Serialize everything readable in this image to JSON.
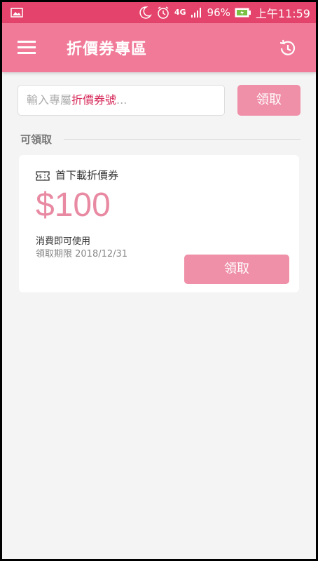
{
  "status_bar": {
    "image_icon": "image-icon",
    "night_icon": "moon-icon",
    "alarm_icon": "alarm-icon",
    "network": "4G",
    "signal_icon": "signal-icon",
    "battery_percent": "96%",
    "battery_icon": "battery-charging-icon",
    "time": "上午11:59"
  },
  "app_bar": {
    "menu_icon": "hamburger-menu-icon",
    "title": "折價券專區",
    "history_icon": "history-icon"
  },
  "code_entry": {
    "placeholder_prefix": "輸入專屬",
    "placeholder_accent": "折價券號",
    "placeholder_suffix": "...",
    "button_label": "領取"
  },
  "section": {
    "label": "可領取"
  },
  "coupon": {
    "icon": "ticket-icon",
    "name": "首下載折價券",
    "amount": "$100",
    "condition": "消費即可使用",
    "period": "領取期限 2018/12/31",
    "button_label": "領取"
  },
  "colors": {
    "status_bar": "#e4436b",
    "app_bar": "#f07a98",
    "button": "#ef8fa8",
    "amount": "#e98aa3",
    "accent_text": "#d62859",
    "background": "#f4f4f4"
  }
}
